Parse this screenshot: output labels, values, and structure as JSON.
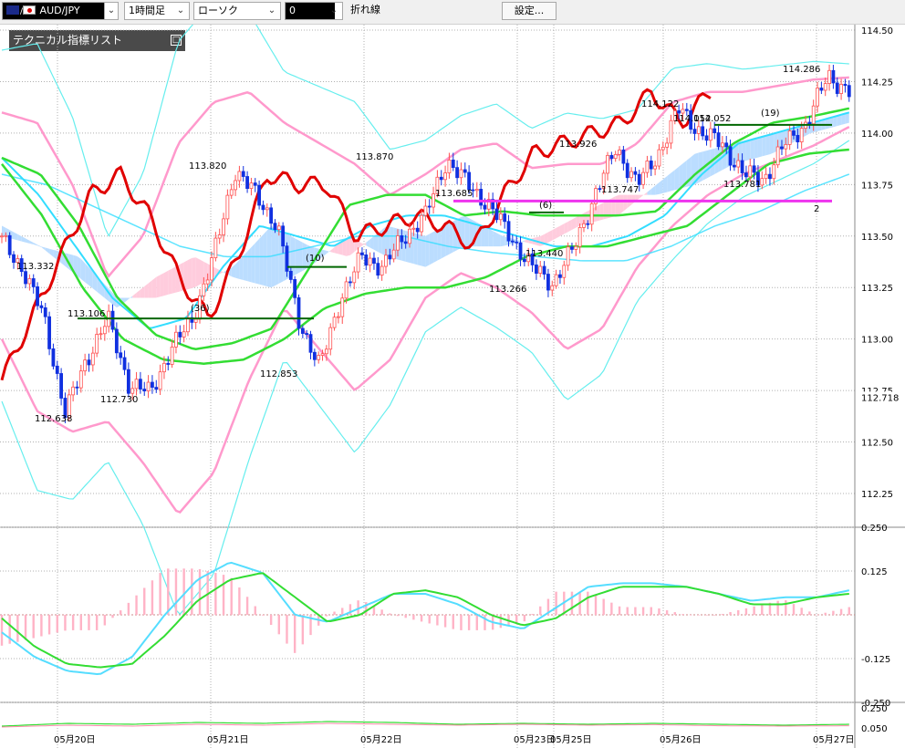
{
  "toolbar": {
    "symbol": "AUD/JPY",
    "timeframe": "1時間足",
    "chart_style": "ローソク",
    "indicator_field": "0",
    "line_label": "折れ線",
    "settings_button": "設定..."
  },
  "tech_panel": {
    "title": "テクニカル指標リスト"
  },
  "colors": {
    "bull": "#ff5050",
    "bear": "#1030e0",
    "tenkan": "#e00000",
    "kijun": "#33dd33",
    "bb_inner": "#ff99cc",
    "bb_outer": "#66eeee",
    "ma_cyan": "#33ddff",
    "cloud_a": "#bbddff",
    "cloud_b": "#ffccdd",
    "magenta": "#ee33ee",
    "dark_green": "#006600"
  },
  "chart_data": [
    {
      "type": "candlestick",
      "ylim": [
        112.175,
        114.525
      ],
      "y_ticks": [
        "114.50",
        "114.25",
        "114.00",
        "113.75",
        "113.50",
        "113.25",
        "113.00",
        "112.75",
        "112.50",
        "112.25"
      ],
      "current_price_label": "112.718",
      "x_labels": [
        "05月20日",
        "05月21日",
        "05月22日",
        "05月23日",
        "05月25日",
        "05月26日",
        "05月27日"
      ],
      "annotations": [
        "113.332",
        "113.106",
        "112.638",
        "112.730",
        "113.820",
        "112.853",
        "113.870",
        "113.685",
        "113.266",
        "113.440",
        "113.926",
        "113.747",
        "114.122",
        "114.052",
        "114.052",
        "113.781",
        "114.286",
        "(36)",
        "(10)",
        "(6)",
        "(19)",
        "2"
      ],
      "levels": [
        113.1,
        113.35,
        113.67,
        113.615,
        114.04
      ]
    },
    {
      "type": "line",
      "ylim": [
        -0.25,
        0.25
      ],
      "y_ticks": [
        "0.250",
        "0.125",
        "-0.125",
        "-0.250"
      ]
    },
    {
      "type": "line",
      "y_ticks": [
        "0.250",
        "0.050"
      ]
    }
  ]
}
